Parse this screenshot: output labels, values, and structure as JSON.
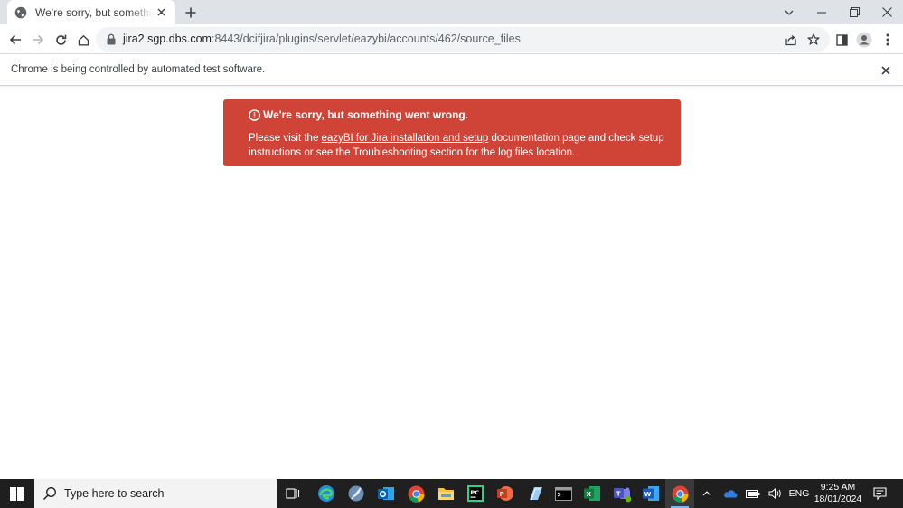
{
  "browser": {
    "tab": {
      "title": "We're sorry, but something went wrong.",
      "favicon": "globe-icon"
    },
    "address": {
      "host": "jira2.sgp.dbs.com",
      "path": ":8443/dcifjira/plugins/servlet/eazybi/accounts/462/source_files"
    },
    "infobar": {
      "message": "Chrome is being controlled by automated test software."
    }
  },
  "alert": {
    "heading": "We're sorry, but something went wrong.",
    "body_before_link": "Please visit the ",
    "link_text": "eazyBI for Jira installation and setup",
    "body_after_link": " documentation page and check setup instructions or see the Troubleshooting section for the log files location.",
    "background_color": "#d04437"
  },
  "taskbar": {
    "search_placeholder": "Type here to search",
    "apps": [
      "task-view-icon",
      "edge-icon",
      "feather-app-icon",
      "outlook-icon",
      "chrome-icon",
      "file-explorer-icon",
      "pycharm-icon",
      "powerpoint-icon",
      "notes-app-icon",
      "terminal-icon",
      "excel-icon",
      "teams-icon",
      "word-icon",
      "chrome-icon"
    ],
    "tray": {
      "language": "ENG",
      "time": "9:25 AM",
      "date": "18/01/2024"
    }
  }
}
